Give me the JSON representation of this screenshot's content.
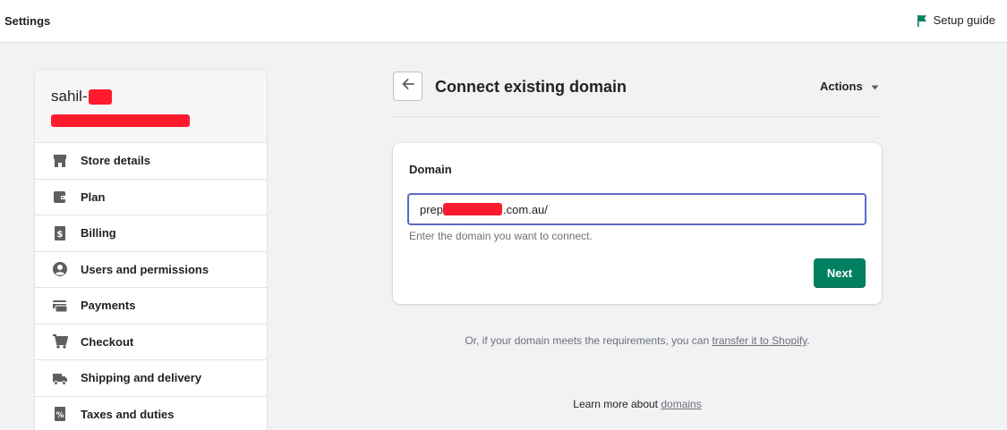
{
  "topbar": {
    "title": "Settings",
    "setup_guide_label": "Setup guide",
    "setup_guide_icon": "flag-icon",
    "flag_color": "#008060"
  },
  "sidebar": {
    "store_name_prefix": "sahil-",
    "items": [
      {
        "label": "Store details",
        "icon": "store-icon"
      },
      {
        "label": "Plan",
        "icon": "wallet-icon"
      },
      {
        "label": "Billing",
        "icon": "billing-icon"
      },
      {
        "label": "Users and permissions",
        "icon": "user-icon"
      },
      {
        "label": "Payments",
        "icon": "payments-icon"
      },
      {
        "label": "Checkout",
        "icon": "cart-icon"
      },
      {
        "label": "Shipping and delivery",
        "icon": "truck-icon"
      },
      {
        "label": "Taxes and duties",
        "icon": "tax-icon"
      }
    ]
  },
  "header": {
    "title": "Connect existing domain",
    "actions_label": "Actions"
  },
  "card": {
    "title": "Domain",
    "input_prefix": "prep",
    "input_suffix": ".com.au/",
    "help_text": "Enter the domain you want to connect.",
    "next_label": "Next"
  },
  "footer": {
    "transfer_text": "Or, if your domain meets the requirements, you can ",
    "transfer_link": "transfer it to Shopify",
    "transfer_end": ".",
    "learn_text": "Learn more about ",
    "learn_link": "domains"
  },
  "colors": {
    "primary": "#008060",
    "focus": "#5c6ac4",
    "redaction": "#ff1a2e"
  }
}
